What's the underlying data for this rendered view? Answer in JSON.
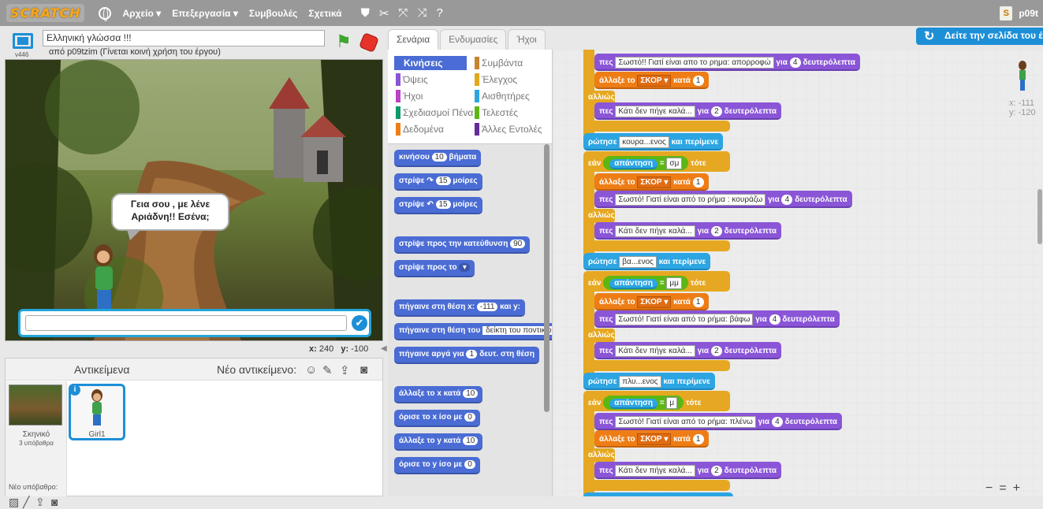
{
  "topbar": {
    "logo": "SCRATCH",
    "menus": [
      "Αρχείο ▾",
      "Επεξεργασία ▾",
      "Συμβουλές",
      "Σχετικά"
    ],
    "username": "p09t",
    "bag_label": "S"
  },
  "stage_header": {
    "version": "v446",
    "project_title": "Ελληνική γλώσσα !!!",
    "byline": "από p09tzim (Γίνεται κοινή χρήση του έργου)"
  },
  "stage": {
    "speech": "Γεια σου , με λένε Αριάδνη!! Εσένα;",
    "answer_check": "✔"
  },
  "mouse": {
    "x_label": "x:",
    "x": "240",
    "y_label": "y:",
    "y": "-100"
  },
  "sprites": {
    "title": "Αντικείμενα",
    "new_sprite": "Νέο αντικείμενο:",
    "stage_name": "Σκηνικό",
    "backdrops": "3 υπόβαθρα",
    "new_backdrop": "Νέο υπόβαθρο:",
    "sprite_name": "Girl1",
    "info": "i"
  },
  "tabs": [
    "Σενάρια",
    "Ενδυμασίες",
    "Ήχοι"
  ],
  "view_project": "Δείτε την σελίδα του έ",
  "categories": [
    {
      "label": "Κινήσεις",
      "color": "#4a6cd4"
    },
    {
      "label": "Συμβάντα",
      "color": "#c88330"
    },
    {
      "label": "Όψεις",
      "color": "#8a55d7"
    },
    {
      "label": "Έλεγχος",
      "color": "#e1a91a"
    },
    {
      "label": "Ήχοι",
      "color": "#bb42c3"
    },
    {
      "label": "Αισθητήρες",
      "color": "#2ca5e2"
    },
    {
      "label": "Σχεδιασμοί Πένα",
      "color": "#0e9a6c"
    },
    {
      "label": "Τελεστές",
      "color": "#5cb712"
    },
    {
      "label": "Δεδομένα",
      "color": "#ee7d16"
    },
    {
      "label": "Άλλες Εντολές",
      "color": "#632d99"
    }
  ],
  "palette_blocks": [
    {
      "pre": "κινήσου",
      "num": "10",
      "post": "βήματα"
    },
    {
      "pre": "στρίψε ↷",
      "num": "15",
      "post": "μοίρες"
    },
    {
      "pre": "στρίψε ↶",
      "num": "15",
      "post": "μοίρες"
    },
    {
      "pre": "στρίψε προς την κατεύθυνση",
      "num": "90",
      "post": ""
    },
    {
      "pre": "στρίψε προς το",
      "num": "",
      "post": "▾"
    },
    {
      "pre": "πήγαινε στη θέση x:",
      "num": "-111",
      "post": "και y:"
    },
    {
      "pre": "πήγαινε στη θέση του",
      "num": "δείκτη του ποντικιού",
      "post": ""
    },
    {
      "pre": "πήγαινε αργά για",
      "num": "1",
      "post": "δευτ. στη θέση"
    },
    {
      "pre": "άλλαξε το x κατά",
      "num": "10",
      "post": ""
    },
    {
      "pre": "όρισε το x ίσο με",
      "num": "0",
      "post": ""
    },
    {
      "pre": "άλλαξε το y κατά",
      "num": "10",
      "post": ""
    },
    {
      "pre": "όρισε το y ίσο με",
      "num": "0",
      "post": ""
    }
  ],
  "script": {
    "say": "πες",
    "for": "για",
    "seconds": "δευτερόλεπτα",
    "change": "άλλαξε το",
    "score_var": "ΣΚΟΡ",
    "by": "κατά",
    "one": "1",
    "two": "2",
    "four": "4",
    "else": "αλλιώς",
    "ask": "ρώτησε",
    "and_wait": "και περίμενε",
    "if": "εάν",
    "then": "τότε",
    "answer": "απάντηση",
    "eq": "=",
    "wrong": "Κάτι δεν πήγε καλά...",
    "msg1": "Σωστό!!  Γιατί είναι απο το ρημα:   απορροφώ",
    "ask1": "κουρα...ενος",
    "ans1": "σμ",
    "msg2": "Σωστό!  Γιατί είναι από το ρήμα :  κουράζω",
    "ask2": "βα...ενος",
    "ans2": "μμ",
    "msg3": "Σωστό! Γιατί είναι από το ρήμα:   βάφω",
    "ask3": "πλυ...ενος",
    "ans3": "μ",
    "msg4": "Σωστό!  Γιατί είναι από το ρήμα:   πλένω"
  },
  "sprite_coords": {
    "x": "x: -111",
    "y": "y: -120"
  },
  "zoom": [
    "−",
    "=",
    "+"
  ]
}
